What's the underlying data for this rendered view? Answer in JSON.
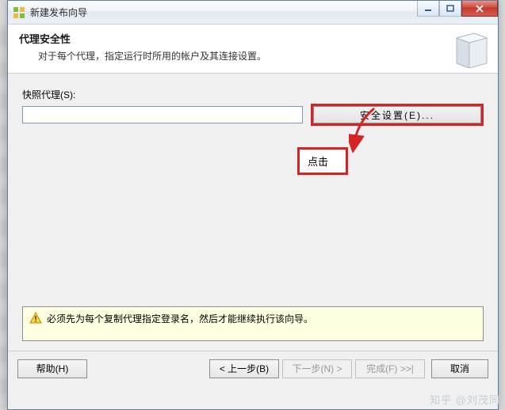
{
  "window": {
    "title": "新建发布向导"
  },
  "header": {
    "title": "代理安全性",
    "subtitle": "对于每个代理，指定运行时所用的帐户及其连接设置。"
  },
  "content": {
    "snapshot_label": "快照代理(S):",
    "snapshot_value": "",
    "security_button": "安全设置(E)..."
  },
  "annotation": {
    "text": "点击"
  },
  "warning": {
    "text": "必须先为每个复制代理指定登录名，然后才能继续执行该向导。"
  },
  "footer": {
    "help": "帮助(H)",
    "back": "< 上一步(B)",
    "next": "下一步(N) >",
    "finish": "完成(F) >>|",
    "cancel": "取消"
  },
  "watermark": "知乎 @刘茂同"
}
